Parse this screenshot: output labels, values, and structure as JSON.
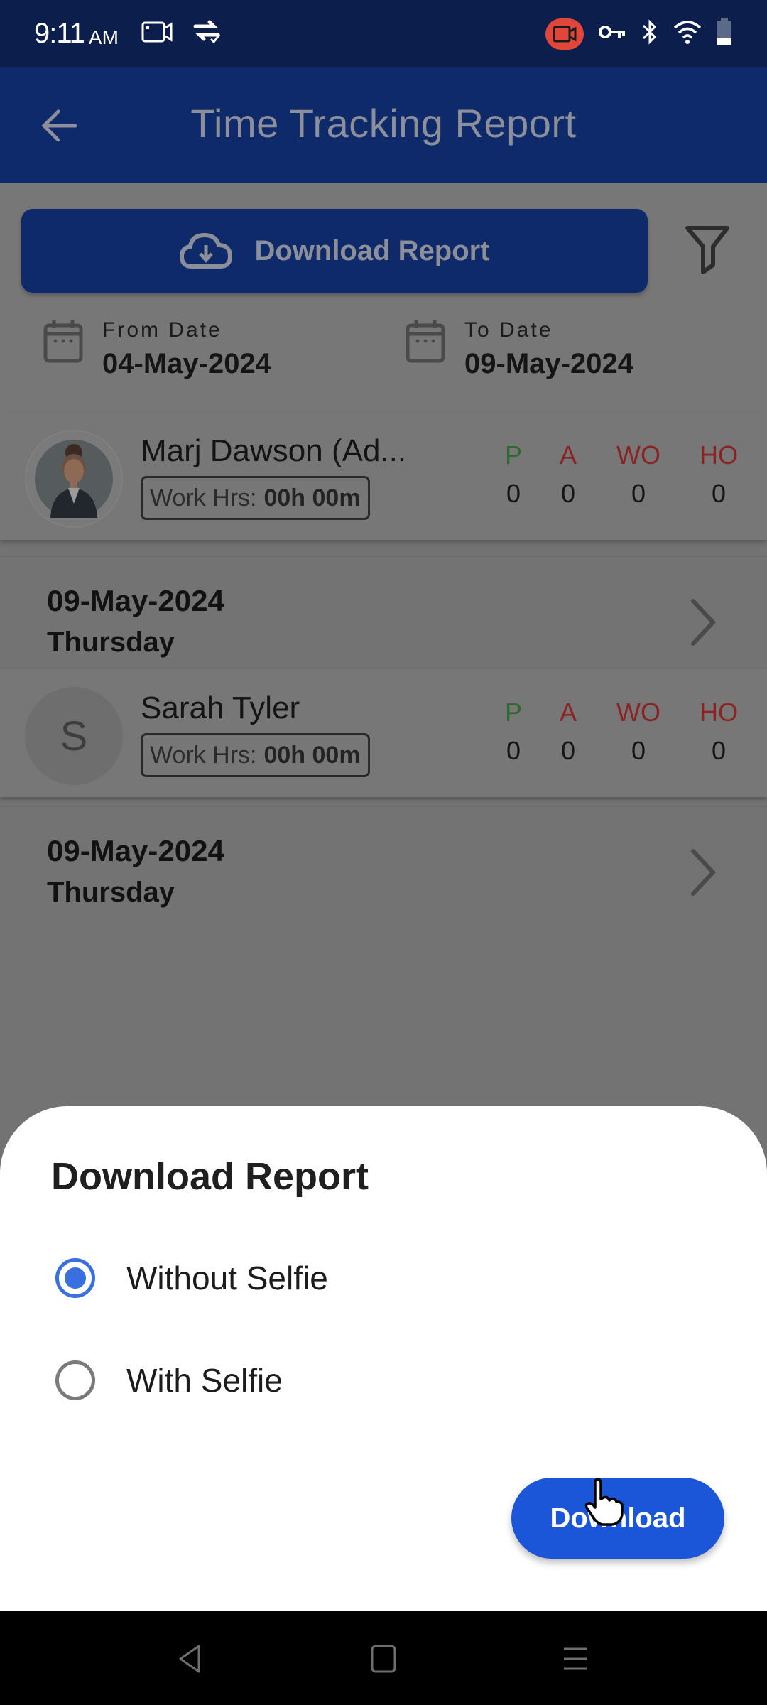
{
  "status_bar": {
    "time": "9:11",
    "ampm": "AM",
    "left_icons": [
      "screen-record-icon",
      "sync-check-icon"
    ],
    "right_icons": [
      "recording-indicator-icon",
      "vpn-key-icon",
      "bluetooth-icon",
      "wifi-icon",
      "battery-icon"
    ]
  },
  "app_bar": {
    "title": "Time Tracking Report",
    "back_icon": "arrow-left-icon"
  },
  "controls": {
    "download_button_label": "Download Report",
    "download_icon": "cloud-download-icon",
    "filter_icon": "filter-funnel-icon",
    "from_date": {
      "label": "From Date",
      "value": "04-May-2024"
    },
    "to_date": {
      "label": "To Date",
      "value": "09-May-2024"
    }
  },
  "stat_labels": {
    "p": "P",
    "a": "A",
    "wo": "WO",
    "ho": "HO"
  },
  "colors": {
    "present": "#3aa03a",
    "absent": "#c83232",
    "accent": "#1c56d8",
    "app_bar": "#0e2a6b"
  },
  "employees": [
    {
      "name": "Marj Dawson (Ad...",
      "avatar": "photo",
      "work_hrs_label": "Work Hrs:",
      "work_hrs_value": "00h 00m",
      "stats": {
        "p": "0",
        "a": "0",
        "wo": "0",
        "ho": "0"
      },
      "day": {
        "date": "09-May-2024",
        "weekday": "Thursday"
      }
    },
    {
      "name": "Sarah Tyler",
      "avatar": "initial",
      "initial": "S",
      "work_hrs_label": "Work Hrs:",
      "work_hrs_value": "00h 00m",
      "stats": {
        "p": "0",
        "a": "0",
        "wo": "0",
        "ho": "0"
      },
      "day": {
        "date": "09-May-2024",
        "weekday": "Thursday"
      }
    }
  ],
  "sheet": {
    "title": "Download Report",
    "options": [
      {
        "label": "Without Selfie",
        "checked": true
      },
      {
        "label": "With Selfie",
        "checked": false
      }
    ],
    "download_label": "Download"
  },
  "nav_bar": {
    "buttons": [
      "back-triangle-icon",
      "home-square-icon",
      "recents-menu-icon"
    ]
  }
}
